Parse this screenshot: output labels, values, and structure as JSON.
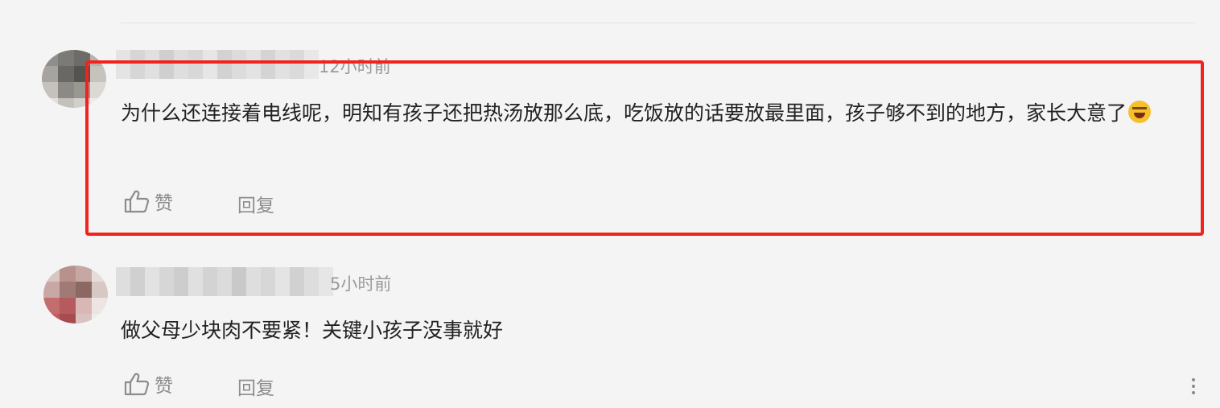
{
  "comments": [
    {
      "timestamp": "12小时前",
      "text": "为什么还连接着电线呢，明知有孩子还把热汤放那么底，吃饭放的话要放最里面，孩子够不到的地方，家长大意了",
      "like_label": "赞",
      "reply_label": "回复"
    },
    {
      "timestamp": "5小时前",
      "text": "做父母少块肉不要紧！关键小孩子没事就好",
      "like_label": "赞",
      "reply_label": "回复"
    }
  ],
  "icons": {
    "like": "thumbs-up-icon",
    "emoji": "rolling-on-floor-laughing-emoji",
    "more": "vertical-ellipsis-icon"
  },
  "colors": {
    "highlight": "#f2231e",
    "background": "#f4f4f4",
    "text": "#222222",
    "muted": "#8c8c8c"
  }
}
